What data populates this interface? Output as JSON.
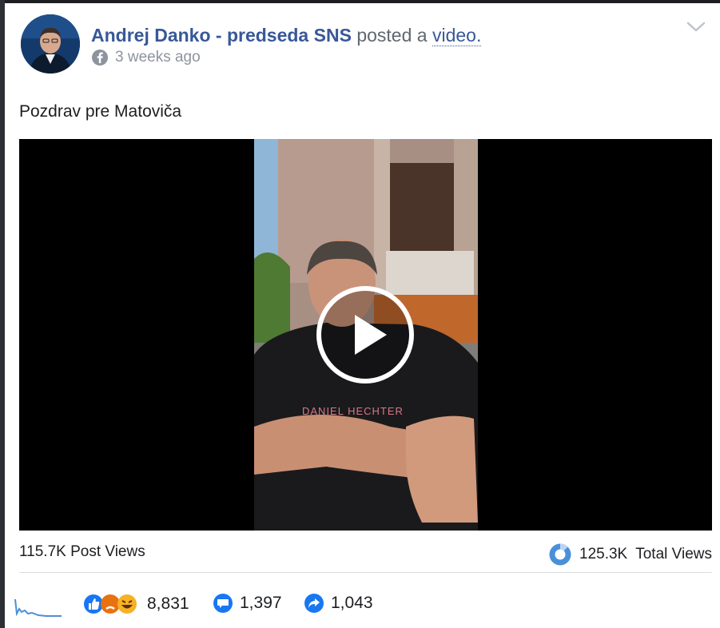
{
  "post": {
    "author": "Andrej Danko - predseda SNS",
    "posted_text": "posted a",
    "video_link": "video.",
    "time": "3 weeks ago",
    "caption": "Pozdrav pre Matoviča"
  },
  "video": {
    "shirt_text": "DANIEL HECHTER"
  },
  "views": {
    "post_views": "115.7K Post Views",
    "total_value": "125.3K",
    "total_label": "Total Views"
  },
  "stats": {
    "reactions": "8,831",
    "comments": "1,397",
    "shares": "1,043"
  },
  "colors": {
    "link_blue": "#385898",
    "fb_blue": "#1877f2",
    "angry_red": "#e9710f",
    "haha_yellow": "#f7b125"
  }
}
